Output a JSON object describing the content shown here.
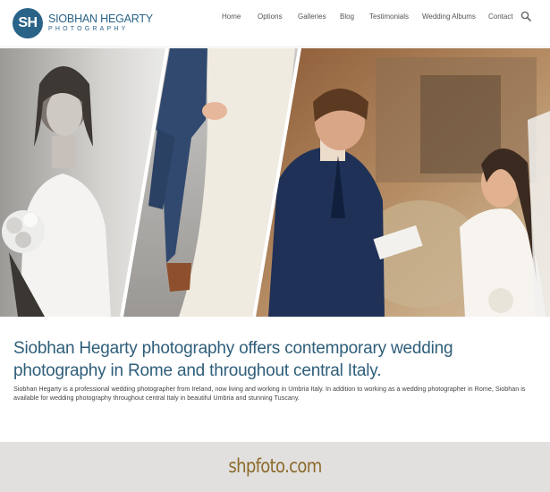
{
  "logo": {
    "mark": "SH",
    "name": "SIOBHAN HEGARTY",
    "sub": "PHOTOGRAPHY"
  },
  "nav": {
    "items": [
      {
        "label": "Home"
      },
      {
        "label": "Options"
      },
      {
        "label": "Galleries"
      },
      {
        "label": "Blog"
      },
      {
        "label": "Testimonials"
      },
      {
        "label": "Wedding Albums"
      },
      {
        "label": "Contact"
      }
    ],
    "search_icon": "search-icon"
  },
  "hero": {
    "panels": [
      "bride-with-bouquet-photo",
      "couple-standing-photo",
      "groom-and-bride-crying-photo"
    ]
  },
  "main": {
    "headline": "Siobhan Hegarty photography offers contemporary wedding photography in Rome and throughout central Italy.",
    "body": "Siobhan Hegarty is a professional wedding photographer from Ireland, now living and working in Umbria Italy. In addition to working as a wedding photographer in Rome, Siobhan is available for wedding photography throughout central Italy in beautiful Umbria and stunning Tuscany."
  },
  "footer": {
    "domain": "shpfoto.com"
  },
  "colors": {
    "brand": "#2a6388",
    "headline": "#2f5e7a",
    "footer_bg": "#e1e0de",
    "footer_text": "#8d6a2c"
  }
}
